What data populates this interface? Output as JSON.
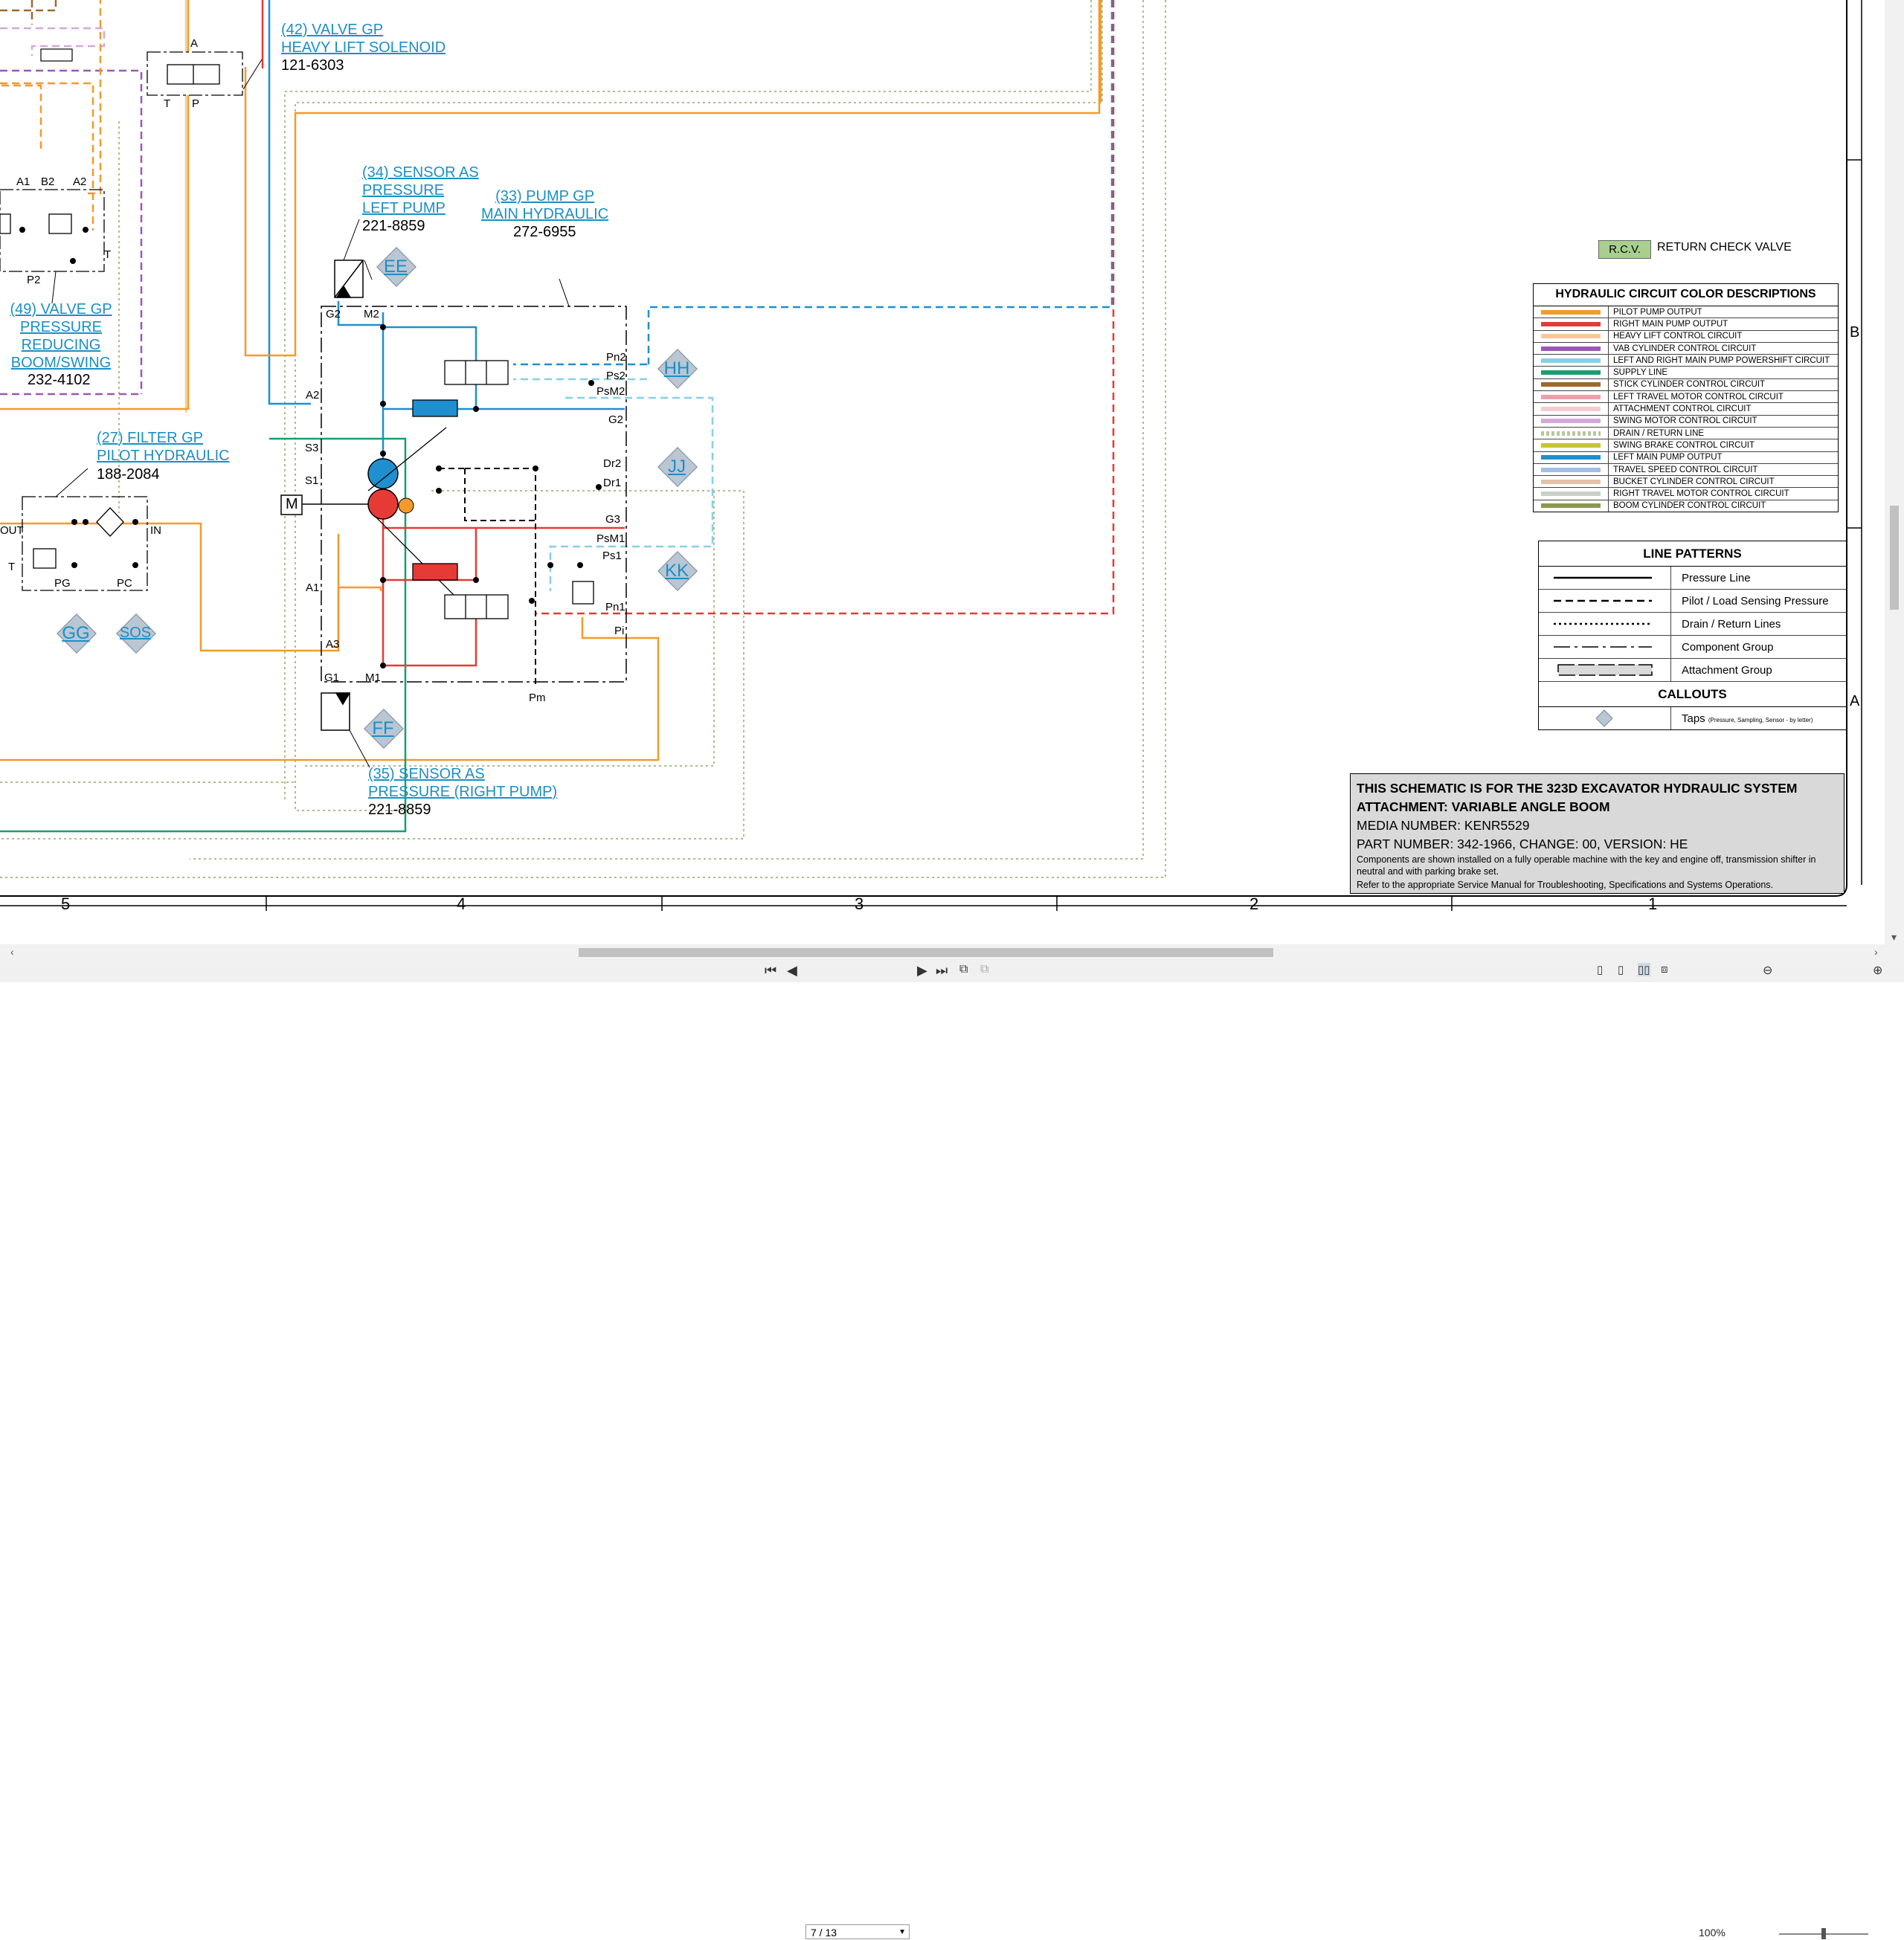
{
  "callouts": {
    "valve42": {
      "title1": "(42) VALVE GP",
      "title2": "HEAVY LIFT SOLENOID",
      "part": "121-6303"
    },
    "sensor34": {
      "title1": "(34) SENSOR AS",
      "title2": "PRESSURE",
      "title3": "LEFT PUMP",
      "part": "221-8859"
    },
    "pump33": {
      "title1": "(33) PUMP GP",
      "title2": "MAIN HYDRAULIC",
      "part": "272-6955"
    },
    "valve49": {
      "title1": "(49) VALVE GP",
      "title2": "PRESSURE",
      "title3": "REDUCING",
      "title4": "BOOM/SWING",
      "part": "232-4102"
    },
    "filter27": {
      "title1": "(27) FILTER GP",
      "title2": "PILOT HYDRAULIC",
      "part": "188-2084"
    },
    "sensor35": {
      "title1": "(35) SENSOR AS",
      "title2": "PRESSURE (RIGHT PUMP)",
      "part": "221-8859"
    }
  },
  "ports": {
    "A": "A",
    "T": "T",
    "P": "P",
    "A1top": "A1",
    "B2": "B2",
    "A2top": "A2",
    "P2": "P2",
    "Tvalve": "T",
    "G2": "G2",
    "M2": "M2",
    "A2": "A2",
    "S3": "S3",
    "S1": "S1",
    "A1": "A1",
    "A3": "A3",
    "G1": "G1",
    "M1": "M1",
    "Pn2": "Pn2",
    "Ps2": "Ps2",
    "PsM2": "PsM2",
    "G2r": "G2",
    "Dr2": "Dr2",
    "Dr1": "Dr1",
    "G3": "G3",
    "PsM1": "PsM1",
    "Ps1": "Ps1",
    "Pn1": "Pn1",
    "Pi": "Pi",
    "Pm": "Pm",
    "OUT": "OUT",
    "IN": "IN",
    "Tf": "T",
    "PG": "PG",
    "PC": "PC",
    "M": "M"
  },
  "taps": {
    "EE": "EE",
    "HH": "HH",
    "JJ": "JJ",
    "KK": "KK",
    "FF": "FF",
    "GG": "GG",
    "SOS": "SOS"
  },
  "columns": {
    "c5": "5",
    "c4": "4",
    "c3": "3",
    "c2": "2",
    "c1": "1"
  },
  "rows": {
    "B": "B",
    "A": "A"
  },
  "rcv": {
    "tag": "R.C.V.",
    "label": "RETURN CHECK VALVE"
  },
  "color_table": {
    "title": "HYDRAULIC CIRCUIT COLOR DESCRIPTIONS",
    "items": [
      {
        "color": "#f39a2a",
        "label": "PILOT PUMP OUTPUT",
        "style": "solid"
      },
      {
        "color": "#e53a36",
        "label": "RIGHT MAIN PUMP OUTPUT",
        "style": "solid"
      },
      {
        "color": "#f7c99a",
        "label": "HEAVY LIFT CONTROL CIRCUIT",
        "style": "solid"
      },
      {
        "color": "#9b59b6",
        "label": "VAB CYLINDER CONTROL CIRCUIT",
        "style": "solid"
      },
      {
        "color": "#86d0e8",
        "label": "LEFT AND RIGHT MAIN PUMP POWERSHIFT CIRCUIT",
        "style": "solid"
      },
      {
        "color": "#1a9e6e",
        "label": "SUPPLY LINE",
        "style": "solid"
      },
      {
        "color": "#9c6a2a",
        "label": "STICK CYLINDER CONTROL CIRCUIT",
        "style": "solid"
      },
      {
        "color": "#eba0a8",
        "label": "LEFT TRAVEL MOTOR CONTROL CIRCUIT",
        "style": "solid"
      },
      {
        "color": "#f5cbd0",
        "label": "ATTACHMENT CONTROL CIRCUIT",
        "style": "solid"
      },
      {
        "color": "#d4a8d8",
        "label": "SWING MOTOR CONTROL CIRCUIT",
        "style": "solid"
      },
      {
        "color": "#b7c79a",
        "label": "DRAIN / RETURN LINE",
        "style": "dotted"
      },
      {
        "color": "#c7c532",
        "label": "SWING BRAKE CONTROL CIRCUIT",
        "style": "solid"
      },
      {
        "color": "#1f8fd0",
        "label": "LEFT MAIN PUMP OUTPUT",
        "style": "solid"
      },
      {
        "color": "#a0bfe2",
        "label": "TRAVEL SPEED CONTROL CIRCUIT",
        "style": "solid"
      },
      {
        "color": "#e3c2a8",
        "label": "BUCKET CYLINDER CONTROL CIRCUIT",
        "style": "solid"
      },
      {
        "color": "#c8d0c8",
        "label": "RIGHT TRAVEL MOTOR CONTROL CIRCUIT",
        "style": "solid"
      },
      {
        "color": "#8b9a4a",
        "label": "BOOM CYLINDER CONTROL CIRCUIT",
        "style": "solid"
      }
    ]
  },
  "line_patterns": {
    "title": "LINE PATTERNS",
    "items": [
      {
        "label": "Pressure Line",
        "style": "solid"
      },
      {
        "label": "Pilot / Load Sensing Pressure",
        "style": "dashed"
      },
      {
        "label": "Drain / Return Lines",
        "style": "dotted"
      },
      {
        "label": "Component Group",
        "style": "dashdot"
      },
      {
        "label": "Attachment Group",
        "style": "box"
      }
    ],
    "callouts_title": "CALLOUTS",
    "taps_label": "Taps",
    "taps_note": "(Pressure, Sampling, Sensor - by letter)"
  },
  "info": {
    "line1": "THIS SCHEMATIC IS FOR THE 323D EXCAVATOR HYDRAULIC SYSTEM",
    "line2": "ATTACHMENT: VARIABLE ANGLE BOOM",
    "line3": "MEDIA NUMBER: KENR5529",
    "line4": "PART NUMBER: 342-1966, CHANGE: 00, VERSION: HE",
    "line5": "Components are shown installed on a fully operable machine with the key and engine off, transmission shifter in neutral and with parking brake set.",
    "line6": "Refer to the appropriate Service Manual for Troubleshooting, Specifications and Systems Operations."
  },
  "toolbar": {
    "page": "7 / 13",
    "zoom": "100%"
  }
}
